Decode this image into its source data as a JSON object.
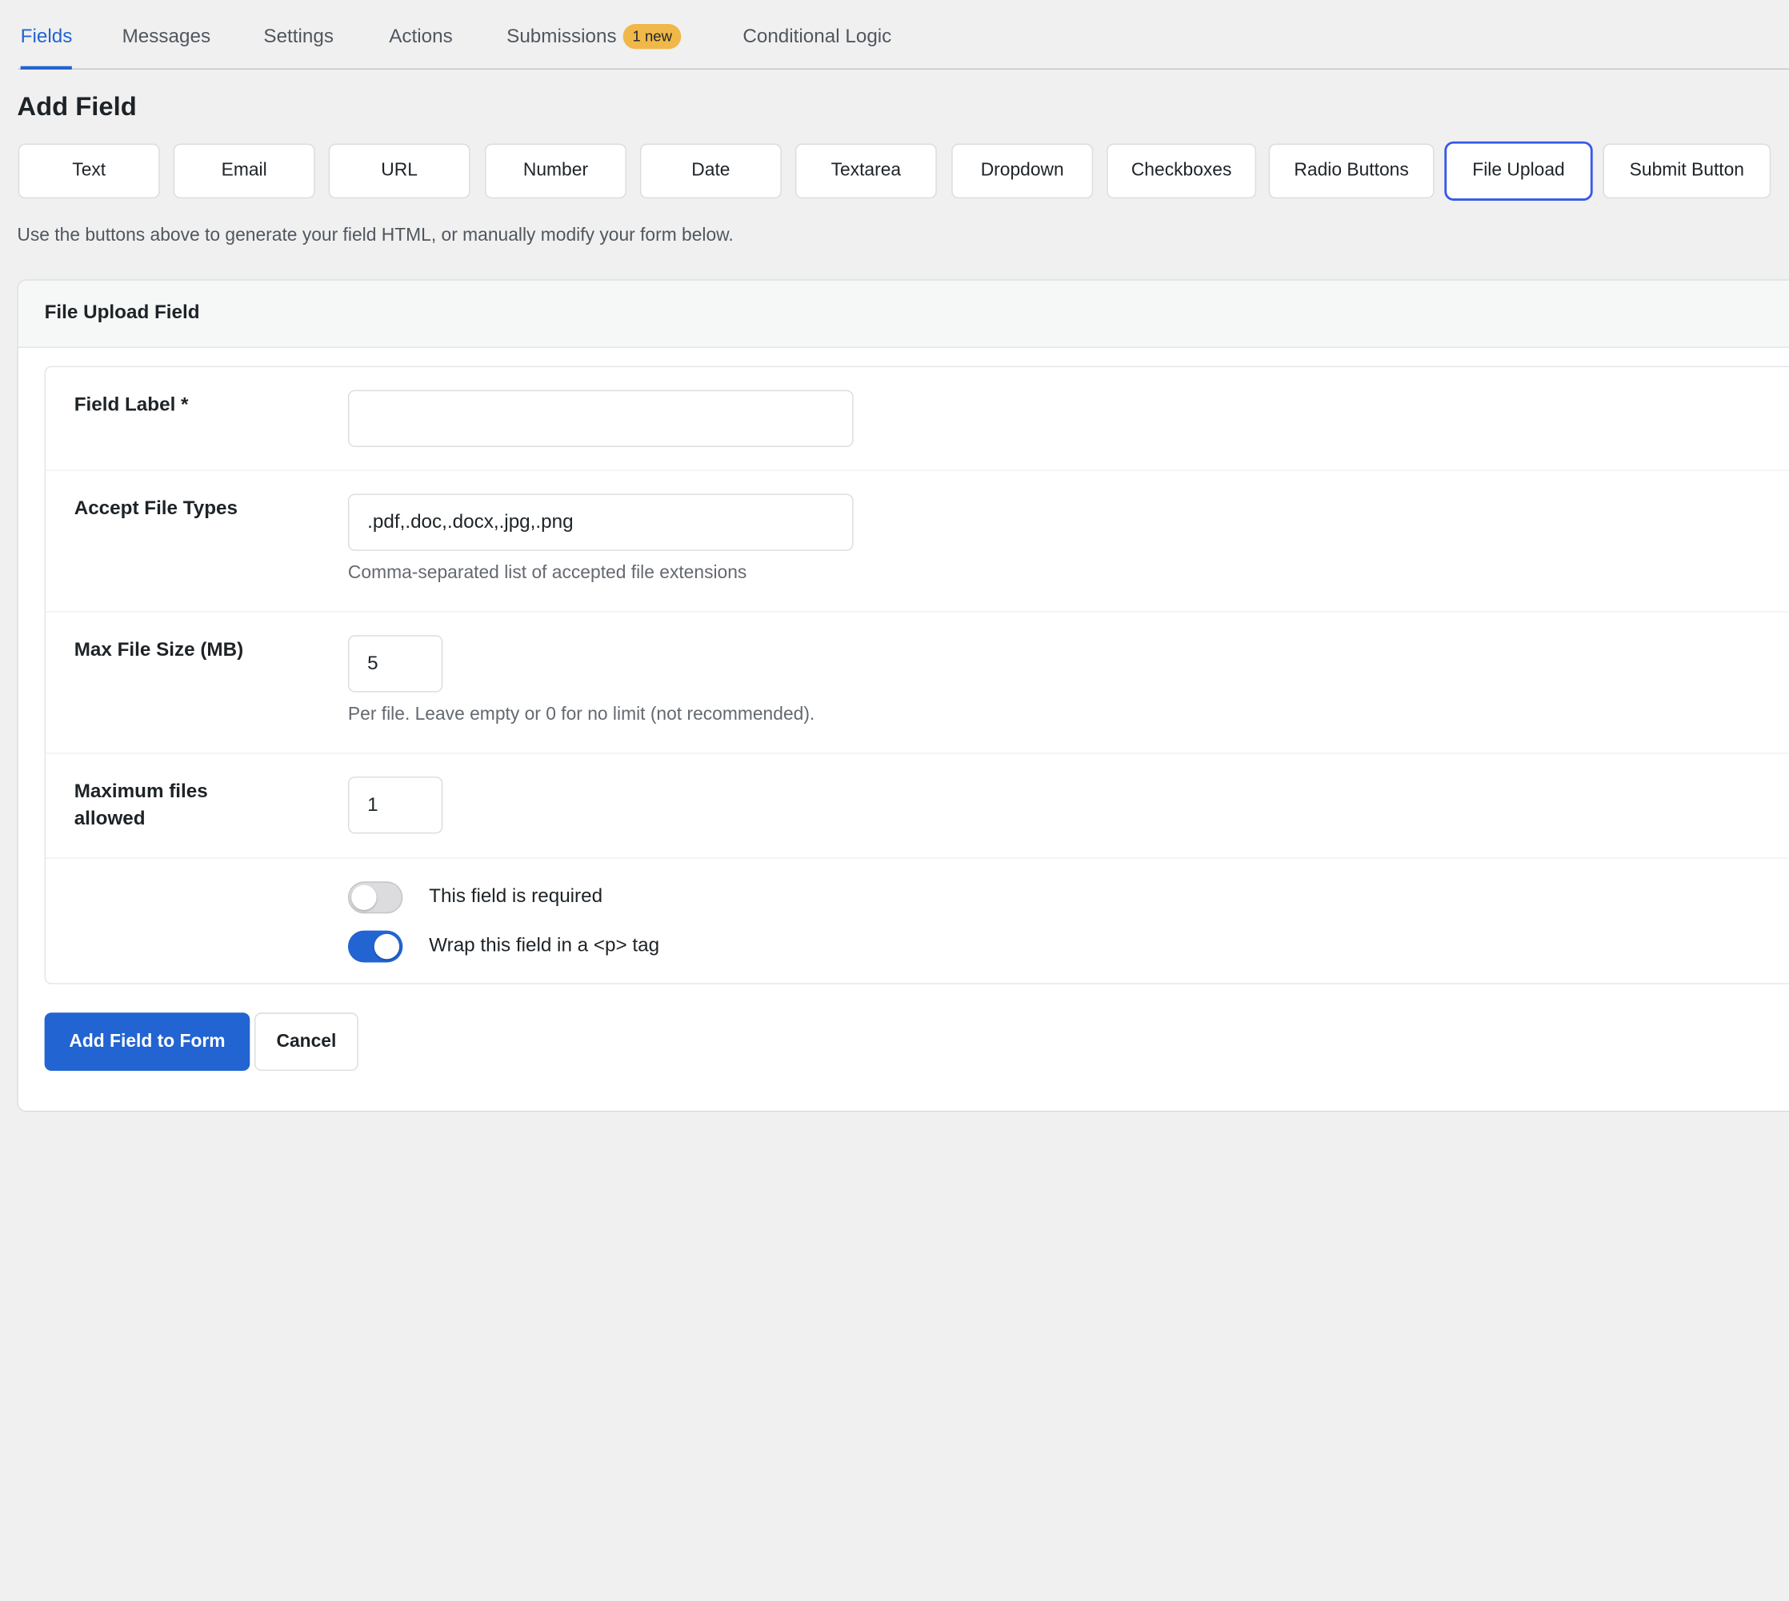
{
  "tabs": [
    {
      "label": "Fields",
      "active": true
    },
    {
      "label": "Messages"
    },
    {
      "label": "Settings"
    },
    {
      "label": "Actions"
    },
    {
      "label": "Submissions",
      "badge": "1 new"
    },
    {
      "label": "Conditional Logic"
    }
  ],
  "add_field": {
    "title": "Add Field",
    "buttons": [
      "Text",
      "Email",
      "URL",
      "Number",
      "Date",
      "Textarea",
      "Dropdown",
      "Checkboxes",
      "Radio Buttons",
      "File Upload",
      "Submit Button"
    ],
    "selected": "File Upload",
    "helper": "Use the buttons above to generate your field HTML, or manually modify your form below."
  },
  "panel": {
    "title": "File Upload Field",
    "field_label": {
      "label": "Field Label *",
      "value": ""
    },
    "accept": {
      "label": "Accept File Types",
      "value": ".pdf,.doc,.docx,.jpg,.png",
      "help": "Comma-separated list of accepted file extensions"
    },
    "max_size": {
      "label": "Max File Size (MB)",
      "value": "5",
      "help": "Per file. Leave empty or 0 for no limit (not recommended)."
    },
    "max_files": {
      "label_line1": "Maximum files",
      "label_line2": "allowed",
      "value": "1"
    },
    "toggles": [
      {
        "label": "This field is required",
        "on": false
      },
      {
        "label": "Wrap this field in a <p> tag",
        "on": true
      }
    ],
    "actions": {
      "primary": "Add Field to Form",
      "secondary": "Cancel"
    }
  },
  "colors": {
    "accent": "#2264d1",
    "badge": "#f0b849",
    "selected_outline": "#3858e9"
  }
}
